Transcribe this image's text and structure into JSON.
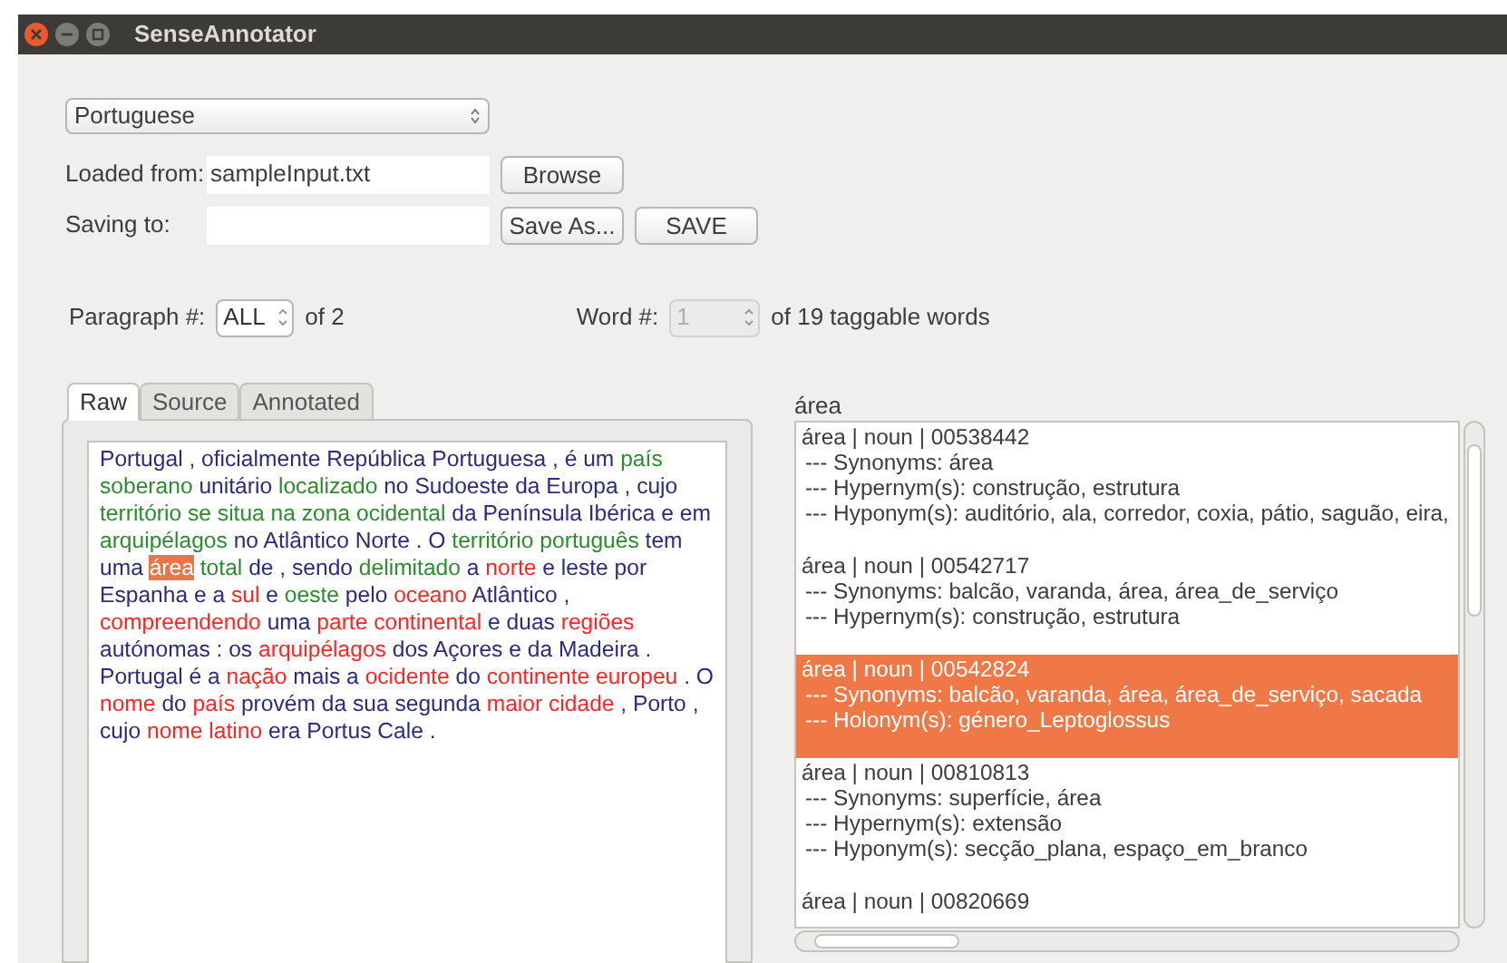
{
  "window": {
    "title": "SenseAnnotator"
  },
  "language": {
    "value": "Portuguese"
  },
  "loaded_from": {
    "label": "Loaded from:",
    "value": "sampleInput.txt",
    "button": "Browse"
  },
  "saving_to": {
    "label": "Saving to:",
    "buttons": [
      "Save As...",
      "SAVE"
    ]
  },
  "paragraph": {
    "label": "Paragraph #:",
    "value": "ALL",
    "of": "of 2",
    "disabled": false
  },
  "word": {
    "label": "Word #:",
    "value": "1",
    "of": "of 19 taggable words",
    "disabled": true
  },
  "tabs": [
    {
      "label": "Raw",
      "selected": true
    },
    {
      "label": "Source",
      "selected": false
    },
    {
      "label": "Annotated",
      "selected": false
    }
  ],
  "text_tokens": [
    {
      "text": "Portugal , oficialmente República Portuguesa , é um",
      "color": "#2c2c7c",
      "selected": false
    },
    {
      "text": "país soberano",
      "color": "#2e8b2e",
      "selected": false
    },
    {
      "text": "unitário",
      "color": "#2c2c7c",
      "selected": false
    },
    {
      "text": "localizado",
      "color": "#2e8b2e",
      "selected": false
    },
    {
      "text": "no Sudoeste da Europa , cujo",
      "color": "#2c2c7c",
      "selected": false
    },
    {
      "text": "território se situa na zona ocidental",
      "color": "#2e8b2e",
      "selected": false
    },
    {
      "text": "da Península Ibérica e em",
      "color": "#2c2c7c",
      "selected": false
    },
    {
      "text": "arquipélagos",
      "color": "#2e8b2e",
      "selected": false
    },
    {
      "text": "no Atlântico Norte . O",
      "color": "#2c2c7c",
      "selected": false
    },
    {
      "text": "território português",
      "color": "#2e8b2e",
      "selected": false
    },
    {
      "text": "tem uma",
      "color": "#2c2c7c",
      "selected": false
    },
    {
      "text": "área",
      "selected": true
    },
    {
      "text": "total",
      "color": "#2e8b2e",
      "selected": false
    },
    {
      "text": "de , sendo",
      "color": "#2c2c7c",
      "selected": false
    },
    {
      "text": "delimitado",
      "color": "#2e8b2e",
      "selected": false
    },
    {
      "text": "a",
      "color": "#2c2c7c",
      "selected": false
    },
    {
      "text": "norte",
      "color": "#ff2424",
      "selected": false
    },
    {
      "text": "e leste por Espanha e a",
      "color": "#2c2c7c",
      "selected": false
    },
    {
      "text": "sul",
      "color": "#ff2424",
      "selected": false
    },
    {
      "text": "e",
      "color": "#2c2c7c",
      "selected": false
    },
    {
      "text": "oeste",
      "color": "#2e8b2e",
      "selected": false
    },
    {
      "text": "pelo",
      "color": "#2c2c7c",
      "selected": false
    },
    {
      "text": "oceano",
      "color": "#ff2424",
      "selected": false
    },
    {
      "text": "Atlântico ,",
      "color": "#2c2c7c",
      "selected": false
    },
    {
      "text": "compreendendo",
      "color": "#ff2424",
      "selected": false
    },
    {
      "text": "uma",
      "color": "#2c2c7c",
      "selected": false
    },
    {
      "text": "parte continental",
      "color": "#ff2424",
      "selected": false
    },
    {
      "text": "e duas",
      "color": "#2c2c7c",
      "selected": false
    },
    {
      "text": "regiões",
      "color": "#ff2424",
      "selected": false
    },
    {
      "text": "autónomas : os",
      "color": "#2c2c7c",
      "selected": false
    },
    {
      "text": "arquipélagos",
      "color": "#ff2424",
      "selected": false
    },
    {
      "text": "dos Açores e da Madeira . Portugal é a",
      "color": "#2c2c7c",
      "selected": false
    },
    {
      "text": "nação",
      "color": "#ff2424",
      "selected": false
    },
    {
      "text": "mais a",
      "color": "#2c2c7c",
      "selected": false
    },
    {
      "text": "ocidente",
      "color": "#ff2424",
      "selected": false
    },
    {
      "text": "do",
      "color": "#2c2c7c",
      "selected": false
    },
    {
      "text": "continente europeu",
      "color": "#ff2424",
      "selected": false
    },
    {
      "text": ". O",
      "color": "#2c2c7c",
      "selected": false
    },
    {
      "text": "nome",
      "color": "#ff2424",
      "selected": false
    },
    {
      "text": "do",
      "color": "#2c2c7c",
      "selected": false
    },
    {
      "text": "país",
      "color": "#ff2424",
      "selected": false
    },
    {
      "text": "provém da sua segunda",
      "color": "#2c2c7c",
      "selected": false
    },
    {
      "text": "maior cidade",
      "color": "#ff2424",
      "selected": false
    },
    {
      "text": ", Porto , cujo",
      "color": "#2c2c7c",
      "selected": false
    },
    {
      "text": "nome latino",
      "color": "#ff2424",
      "selected": false
    },
    {
      "text": "era Portus Cale .",
      "color": "#2c2c7c",
      "selected": false
    }
  ],
  "senses": {
    "word": "área",
    "entries": [
      {
        "lines": [
          "área | noun | 00538442",
          "--- Synonyms: área",
          "--- Hypernym(s): construção, estrutura",
          "--- Hyponym(s): auditório, ala, corredor, coxia, pátio, saguão, eira,"
        ],
        "selected": false
      },
      {
        "lines": [
          "área | noun | 00542717",
          "--- Synonyms: balcão, varanda, área, área_de_serviço",
          "--- Hypernym(s): construção, estrutura"
        ],
        "selected": false
      },
      {
        "lines": [
          "área | noun | 00542824",
          "--- Synonyms: balcão, varanda, área, área_de_serviço, sacada",
          "--- Holonym(s): género_Leptoglossus"
        ],
        "selected": true
      },
      {
        "lines": [
          "área | noun | 00810813",
          "--- Synonyms: superfície, área",
          "--- Hypernym(s): extensão",
          "--- Hyponym(s): secção_plana, espaço_em_branco"
        ],
        "selected": false
      },
      {
        "lines": [
          "área | noun | 00820669"
        ],
        "selected": false
      }
    ]
  }
}
